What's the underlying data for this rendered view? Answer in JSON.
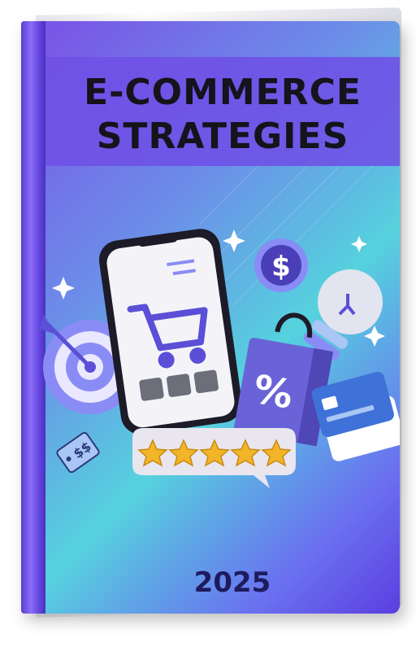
{
  "cover": {
    "title_line1": "E-COMMERCE",
    "title_line2": "STRATEGIES",
    "year": "2025"
  },
  "artwork": {
    "icons": [
      "smartphone-icon",
      "shopping-cart-icon",
      "target-icon",
      "price-tag-icon",
      "dollar-coin-icon",
      "shopping-bag-percent-icon",
      "credit-card-icon",
      "lightbulb-icon",
      "five-star-rating-icon",
      "sparkle-icon"
    ],
    "price_tag_symbol": "$$",
    "coin_symbol": "$",
    "bag_symbol": "%",
    "rating_stars": 5
  },
  "colors": {
    "cover_purple": "#7b4fe6",
    "cover_teal": "#56d2de",
    "title_band": "#6e50e6",
    "title_text": "#15131b",
    "year_text": "#1e1a5e"
  }
}
